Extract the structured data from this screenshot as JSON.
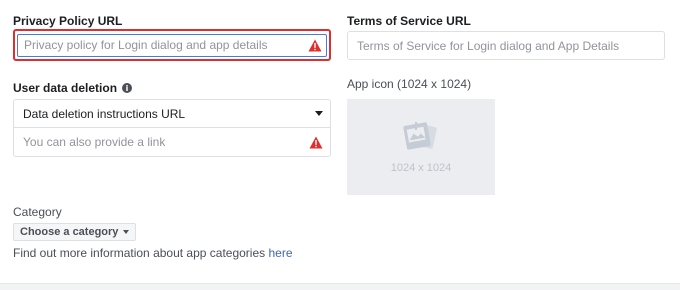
{
  "privacy_policy": {
    "label": "Privacy Policy URL",
    "placeholder": "Privacy policy for Login dialog and app details"
  },
  "terms_of_service": {
    "label": "Terms of Service URL",
    "placeholder": "Terms of Service for Login dialog and App Details"
  },
  "user_data_deletion": {
    "label": "User data deletion",
    "info_icon": "i",
    "select_value": "Data deletion instructions URL",
    "link_placeholder": "You can also provide a link"
  },
  "app_icon": {
    "label": "App icon (1024 x 1024)",
    "size_text": "1024 x 1024"
  },
  "category": {
    "label": "Category",
    "button_label": "Choose a category",
    "help_text": "Find out more information about app categories",
    "help_link": "here"
  },
  "colors": {
    "error": "#e02e2e",
    "focus": "#4a7bd8",
    "link": "#4267b2"
  }
}
